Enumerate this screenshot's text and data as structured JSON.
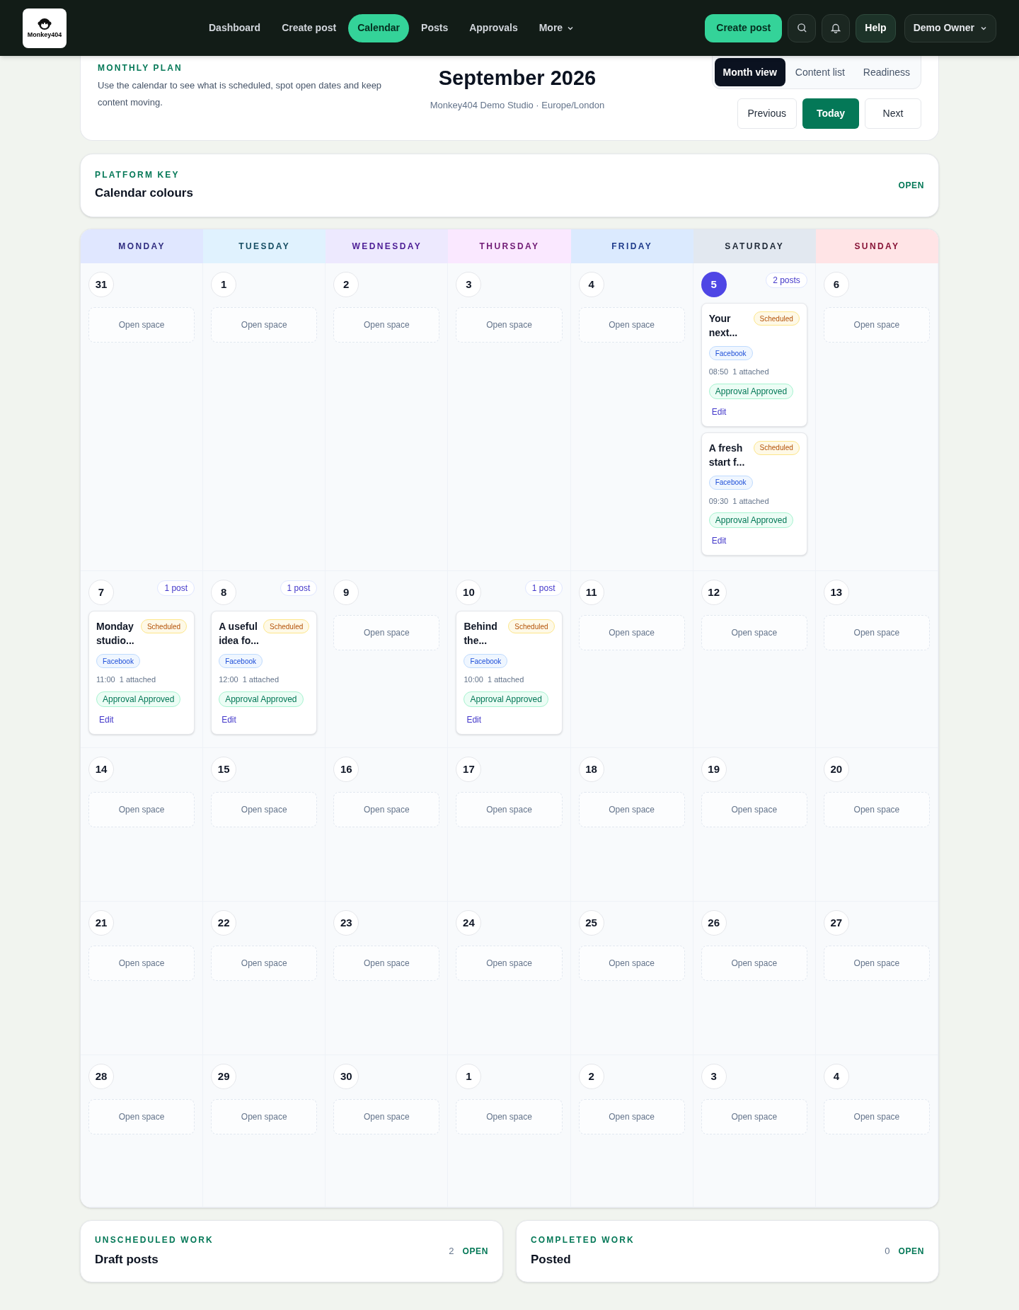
{
  "nav": {
    "logo_text": "Monkey404",
    "items": [
      {
        "label": "Dashboard",
        "selected": false
      },
      {
        "label": "Create post",
        "selected": false
      },
      {
        "label": "Calendar",
        "selected": true
      },
      {
        "label": "Posts",
        "selected": false
      },
      {
        "label": "Approvals",
        "selected": false
      },
      {
        "label": "More",
        "selected": false,
        "kind": "menu"
      }
    ],
    "create_button": "Create post",
    "help": "Help",
    "user": "Demo Owner"
  },
  "plan": {
    "eyebrow": "MONTHLY PLAN",
    "description": "Use the calendar to see what is scheduled, spot open dates and keep content moving.",
    "month": "September 2026",
    "subtitle": "Monkey404 Demo Studio · Europe/London",
    "views": [
      {
        "label": "Month view",
        "selected": true
      },
      {
        "label": "Content list",
        "selected": false
      },
      {
        "label": "Readiness",
        "selected": false
      }
    ],
    "buttons": [
      {
        "label": "Previous",
        "selected": false
      },
      {
        "label": "Today",
        "selected": true
      },
      {
        "label": "Next",
        "selected": false
      }
    ]
  },
  "platform_key": {
    "eyebrow": "PLATFORM KEY",
    "title": "Calendar colours",
    "action": "OPEN"
  },
  "calendar": {
    "weekdays": [
      {
        "label": "MONDAY",
        "color": "#312e81"
      },
      {
        "label": "TUESDAY",
        "color": "#164e63"
      },
      {
        "label": "WEDNESDAY",
        "color": "#4c1d95"
      },
      {
        "label": "THURSDAY",
        "color": "#701a75"
      },
      {
        "label": "FRIDAY",
        "color": "#1e3a8a"
      },
      {
        "label": "SATURDAY",
        "color": "#1f2937"
      },
      {
        "label": "SUNDAY",
        "color": "#881337"
      }
    ],
    "weeks": [
      [
        {
          "day": "31",
          "today": false,
          "empty_label": "Open space"
        },
        {
          "day": "1",
          "today": false,
          "empty_label": "Open space"
        },
        {
          "day": "2",
          "today": false,
          "empty_label": "Open space"
        },
        {
          "day": "3",
          "today": false,
          "empty_label": "Open space"
        },
        {
          "day": "4",
          "today": false,
          "empty_label": "Open space"
        },
        {
          "day": "5",
          "today": true,
          "count": "2 posts",
          "posts": [
            {
              "title": "Your next...",
              "status": "Scheduled",
              "platform": "Facebook",
              "time": "08:50",
              "attachments": "1 attached",
              "approval": "Approval Approved",
              "action": "Edit"
            },
            {
              "title": "A fresh start f...",
              "status": "Scheduled",
              "platform": "Facebook",
              "time": "09:30",
              "attachments": "1 attached",
              "approval": "Approval Approved",
              "action": "Edit"
            }
          ]
        },
        {
          "day": "6",
          "today": false,
          "empty_label": "Open space"
        }
      ],
      [
        {
          "day": "7",
          "today": false,
          "count": "1 post",
          "posts": [
            {
              "title": "Monday studio...",
              "status": "Scheduled",
              "platform": "Facebook",
              "time": "11:00",
              "attachments": "1 attached",
              "approval": "Approval Approved",
              "action": "Edit"
            }
          ]
        },
        {
          "day": "8",
          "today": false,
          "count": "1 post",
          "posts": [
            {
              "title": "A useful idea fo...",
              "status": "Scheduled",
              "platform": "Facebook",
              "time": "12:00",
              "attachments": "1 attached",
              "approval": "Approval Approved",
              "action": "Edit"
            }
          ]
        },
        {
          "day": "9",
          "today": false,
          "empty_label": "Open space"
        },
        {
          "day": "10",
          "today": false,
          "count": "1 post",
          "posts": [
            {
              "title": "Behind the...",
              "status": "Scheduled",
              "platform": "Facebook",
              "time": "10:00",
              "attachments": "1 attached",
              "approval": "Approval Approved",
              "action": "Edit"
            }
          ]
        },
        {
          "day": "11",
          "today": false,
          "empty_label": "Open space"
        },
        {
          "day": "12",
          "today": false,
          "empty_label": "Open space"
        },
        {
          "day": "13",
          "today": false,
          "empty_label": "Open space"
        }
      ],
      [
        {
          "day": "14",
          "today": false,
          "empty_label": "Open space"
        },
        {
          "day": "15",
          "today": false,
          "empty_label": "Open space"
        },
        {
          "day": "16",
          "today": false,
          "empty_label": "Open space"
        },
        {
          "day": "17",
          "today": false,
          "empty_label": "Open space"
        },
        {
          "day": "18",
          "today": false,
          "empty_label": "Open space"
        },
        {
          "day": "19",
          "today": false,
          "empty_label": "Open space"
        },
        {
          "day": "20",
          "today": false,
          "empty_label": "Open space"
        }
      ],
      [
        {
          "day": "21",
          "today": false,
          "empty_label": "Open space"
        },
        {
          "day": "22",
          "today": false,
          "empty_label": "Open space"
        },
        {
          "day": "23",
          "today": false,
          "empty_label": "Open space"
        },
        {
          "day": "24",
          "today": false,
          "empty_label": "Open space"
        },
        {
          "day": "25",
          "today": false,
          "empty_label": "Open space"
        },
        {
          "day": "26",
          "today": false,
          "empty_label": "Open space"
        },
        {
          "day": "27",
          "today": false,
          "empty_label": "Open space"
        }
      ],
      [
        {
          "day": "28",
          "today": false,
          "empty_label": "Open space"
        },
        {
          "day": "29",
          "today": false,
          "empty_label": "Open space"
        },
        {
          "day": "30",
          "today": false,
          "empty_label": "Open space"
        },
        {
          "day": "1",
          "today": false,
          "empty_label": "Open space"
        },
        {
          "day": "2",
          "today": false,
          "empty_label": "Open space"
        },
        {
          "day": "3",
          "today": false,
          "empty_label": "Open space"
        },
        {
          "day": "4",
          "today": false,
          "empty_label": "Open space"
        }
      ]
    ]
  },
  "summaries": [
    {
      "eyebrow": "UNSCHEDULED WORK",
      "title": "Draft posts",
      "count": "2",
      "action": "OPEN"
    },
    {
      "eyebrow": "COMPLETED WORK",
      "title": "Posted",
      "count": "0",
      "action": "OPEN"
    }
  ]
}
